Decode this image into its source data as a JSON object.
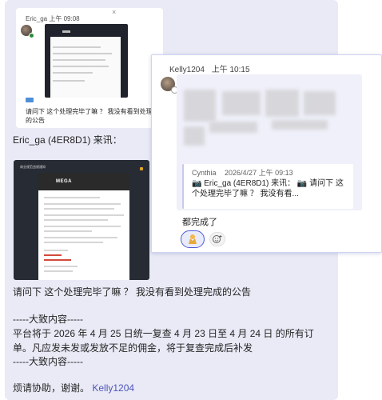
{
  "quoted_card": {
    "name_time": "Eric_ga  上午 09:08",
    "close_glyph": "×",
    "text": "请问下 这个处理完毕了嘛 ？ 我没有看到处理完成的公告"
  },
  "message": {
    "from_line": "Eric_ga (4ER8D1) 来讯：",
    "attachment": {
      "title": "商业规范违规通知",
      "logo": "MEGA"
    },
    "question": "请问下 这个处理完毕了嘛 ？  我没有看到处理完成的公告",
    "divider_start": "-----大致内容-----",
    "content_line1": "平台将于 2026 年 4 月 25 日统一复查 4 月 23 日至 4 月 24 日 的所有订",
    "content_line2": "单。凡应发未发或发放不足的佣金，将于复查完成后补发",
    "divider_end": "-----大致内容-----",
    "closing": "烦请协助，谢谢。",
    "mention": "Kelly1204"
  },
  "reply_popup": {
    "author": "Kelly1204",
    "time": "上午 10:15",
    "quote": {
      "author": "Cynthia",
      "time": "2026/4/27 上午 09:13",
      "text": "📷 Eric_ga (4ER8D1) 来讯： 📷 请问下 这个处理完毕了嘛 ？ 我没有看..."
    },
    "reply_text": "都完成了",
    "reaction_icon": "raising-hands-icon",
    "add_reaction_icon": "add-emoji-icon"
  },
  "colors": {
    "bubble": "#e9eaf6",
    "mention": "#4e55b8",
    "reaction_border": "#4f5bd5",
    "popup_border": "#cfd4f2"
  }
}
